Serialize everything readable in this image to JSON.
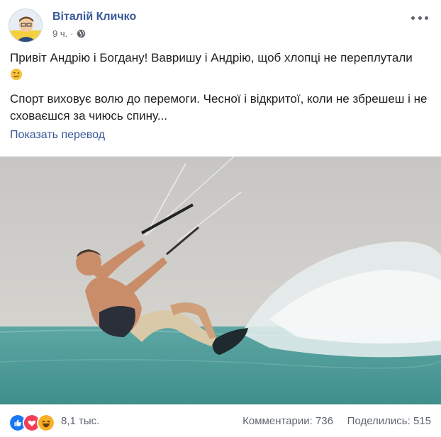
{
  "post": {
    "author": "Віталій Кличко",
    "time": "9 ч.",
    "separator": "·",
    "text_line1": "Привіт Андрію і Богдану! Вавришу і Андрію, щоб хлопці не переплутали",
    "text_paragraph2": "Спорт виховує волю до перемоги. Чесної і відкритої, коли не збрешеш і не сховаєшся за чиюсь спину...",
    "translate_link": "Показать перевод"
  },
  "footer": {
    "reactions": [
      "like-icon",
      "love-icon",
      "haha-icon"
    ],
    "reaction_count": "8,1 тыс.",
    "comments": "Комментарии: 736",
    "shares": "Поделились: 515"
  },
  "colors": {
    "link": "#385898",
    "text": "#1c1e21",
    "muted": "#616770",
    "like": "#1877f2",
    "love": "#f33e58",
    "haha": "#f7b125"
  }
}
